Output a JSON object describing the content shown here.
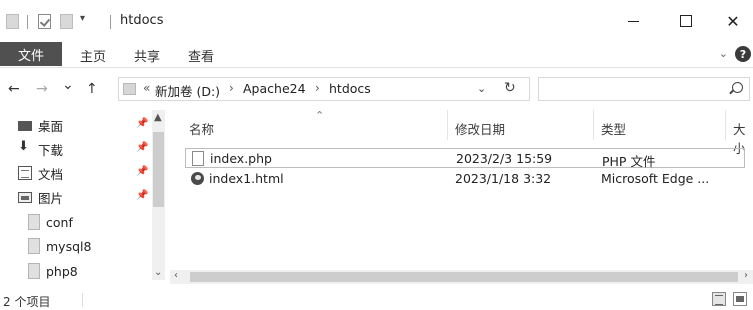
{
  "window": {
    "title": "htdocs",
    "close_glyph": "✕"
  },
  "ribbon": {
    "tabs": [
      "文件",
      "主页",
      "共享",
      "查看"
    ]
  },
  "nav": {
    "back": "←",
    "forward": "→",
    "recent": "⌄",
    "up": "↑"
  },
  "address": {
    "overflow": "«",
    "segments": [
      "新加卷 (D:)",
      "Apache24",
      "htdocs"
    ],
    "separator": "›"
  },
  "search": {
    "placeholder": ""
  },
  "nav_pane": {
    "items": [
      {
        "label": "桌面",
        "icon": "desktop-icon",
        "pinned": true
      },
      {
        "label": "下载",
        "icon": "download-icon",
        "pinned": true
      },
      {
        "label": "文档",
        "icon": "document-icon",
        "pinned": true
      },
      {
        "label": "图片",
        "icon": "pictures-icon",
        "pinned": true
      },
      {
        "label": "conf",
        "icon": "folder-icon",
        "pinned": false
      },
      {
        "label": "mysql8",
        "icon": "folder-icon",
        "pinned": false
      },
      {
        "label": "php8",
        "icon": "folder-icon",
        "pinned": false
      }
    ]
  },
  "file_list": {
    "columns": [
      "名称",
      "修改日期",
      "类型",
      "大小"
    ],
    "rows": [
      {
        "name": "index.php",
        "modified": "2023/2/3 15:59",
        "type": "PHP 文件",
        "icon": "php-file-icon"
      },
      {
        "name": "index1.html",
        "modified": "2023/1/18 3:32",
        "type": "Microsoft Edge ...",
        "icon": "edge-icon"
      }
    ]
  },
  "status": {
    "item_count": "2 个项目"
  },
  "colors": {
    "file_tab_bg": "#505050",
    "selection_border": "#bdbdbd",
    "scroll_track": "#f0f0f0",
    "scroll_thumb": "#cdcdcd"
  }
}
